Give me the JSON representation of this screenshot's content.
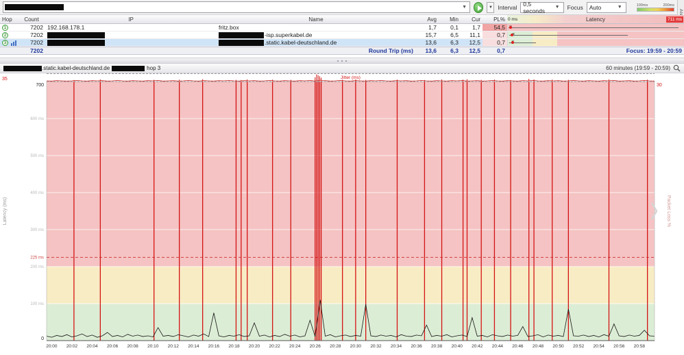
{
  "toolbar": {
    "interval_label": "Interval",
    "interval_value": "0,5 seconds",
    "focus_label": "Focus",
    "focus_value": "Auto",
    "legend": {
      "t1": "100ms",
      "t2": "200ms"
    },
    "alerts_tab": "Alerts"
  },
  "table": {
    "headers": {
      "hop": "Hop",
      "count": "Count",
      "ip": "IP",
      "name": "Name",
      "avg": "Avg",
      "min": "Min",
      "cur": "Cur",
      "pl": "PL%",
      "latency": "Latency",
      "lat_left": "0 ms",
      "lat_right": "711 ms"
    },
    "rows": [
      {
        "hop": "1",
        "count": "7202",
        "ip": "192.168.178.1",
        "name": "fritz.box",
        "avg": "1,7",
        "min": "0,1",
        "cur": "1,7",
        "pl": "54,5",
        "bar": {
          "min_pct": 0.5,
          "max_pct": 97,
          "cur_pct": 0.8,
          "avg_pct": 0.8
        }
      },
      {
        "hop": "2",
        "count": "7202",
        "ip": "",
        "name": "-isp.superkabel.de",
        "avg": "15,7",
        "min": "6,5",
        "cur": "11,1",
        "pl": "0,7",
        "bar": {
          "min_pct": 0.9,
          "max_pct": 68,
          "cur_pct": 1.6,
          "avg_pct": 2.4
        }
      },
      {
        "hop": "3",
        "count": "7202",
        "ip": "",
        "name": ".static.kabel-deutschland.de",
        "avg": "13,6",
        "min": "6,3",
        "cur": "12,5",
        "pl": "0,7",
        "bar": {
          "min_pct": 0.9,
          "max_pct": 16,
          "cur_pct": 1.8,
          "avg_pct": 2.1
        }
      }
    ],
    "summary": {
      "count": "7202",
      "label": "Round Trip (ms)",
      "avg": "13,6",
      "min": "6,3",
      "cur": "12,5",
      "pl": "0,7",
      "focus": "Focus: 19:59 - 20:59"
    }
  },
  "graph_header": {
    "name_suffix": ".static.kabel-deutschland.de",
    "hop_label": "hop 3",
    "range_label": "60 minutes (19:59 - 20:59)"
  },
  "colors": {
    "red": "#d41313",
    "threshold": "#d04545",
    "zone_red": "#f5c3c3",
    "zone_yellow": "#f8ecc4",
    "zone_green": "#dcedd5",
    "badge_green": "#3f9e3f",
    "selection_blue": "#cfe4f7",
    "summary_blue": "#20379b"
  },
  "chart_data": {
    "type": "line",
    "ylabel": "Latency (ms)",
    "y_right_label": "Packet Loss %",
    "ylim": [
      0,
      700
    ],
    "y_axis_top_label": "700",
    "y_axis_bottom_label": "0",
    "right_axis_top_label": "30",
    "jitter_scale_label": "35",
    "jitter_label": "Jitter (ms)",
    "threshold_ms": 225,
    "threshold_label": "225 ms",
    "zone_green_max_ms": 100,
    "zone_yellow_max_ms": 200,
    "gridline_step_ms": 100,
    "duration_min": 60,
    "x_ticks": [
      "20:00",
      "20:02",
      "20:04",
      "20:06",
      "20:08",
      "20:10",
      "20:12",
      "20:14",
      "20:16",
      "20:18",
      "20:20",
      "20:22",
      "20:24",
      "20:26",
      "20:28",
      "20:30",
      "20:32",
      "20:34",
      "20:36",
      "20:38",
      "20:40",
      "20:42",
      "20:44",
      "20:46",
      "20:48",
      "20:50",
      "20:52",
      "20:54",
      "20:56",
      "20:58"
    ],
    "packet_loss_events": [
      [
        2.7,
        6
      ],
      [
        5.3,
        9
      ],
      [
        10.6,
        7
      ],
      [
        13.1,
        8
      ],
      [
        15.4,
        10
      ],
      [
        18.7,
        7
      ],
      [
        19.2,
        6
      ],
      [
        19.8,
        9
      ],
      [
        22.3,
        8
      ],
      [
        24.1,
        7
      ],
      [
        26.5,
        20
      ],
      [
        26.65,
        35
      ],
      [
        26.8,
        30
      ],
      [
        26.95,
        25
      ],
      [
        27.1,
        18
      ],
      [
        29.2,
        8
      ],
      [
        30.5,
        9
      ],
      [
        31.5,
        7
      ],
      [
        34.6,
        8
      ],
      [
        37.3,
        6
      ],
      [
        39.0,
        9
      ],
      [
        41.1,
        8
      ],
      [
        41.5,
        10
      ],
      [
        42.9,
        7
      ],
      [
        44.2,
        8
      ],
      [
        45.8,
        6
      ],
      [
        47.6,
        12
      ],
      [
        48.1,
        9
      ],
      [
        49.9,
        8
      ],
      [
        51.5,
        7
      ],
      [
        55.5,
        9
      ],
      [
        59.3,
        8
      ]
    ],
    "latency_samples_ms": [
      12,
      9,
      14,
      11,
      16,
      10,
      13,
      18,
      11,
      15,
      9,
      13,
      22,
      11,
      14,
      10,
      17,
      12,
      15,
      11,
      13,
      10,
      35,
      12,
      14,
      11,
      16,
      13,
      10,
      15,
      12,
      18,
      11,
      75,
      13,
      10,
      14,
      12,
      16,
      11,
      13,
      48,
      12,
      15,
      10,
      14,
      11,
      17,
      12,
      15,
      10,
      13,
      55,
      11,
      110,
      12,
      16,
      10,
      13,
      15,
      11,
      14,
      12,
      98,
      13,
      11,
      15,
      12,
      14,
      10,
      16,
      12,
      11,
      15,
      13,
      42,
      11,
      14,
      12,
      16,
      10,
      13,
      15,
      11,
      62,
      12,
      14,
      10,
      16,
      13,
      11,
      15,
      12,
      14,
      38,
      11,
      13,
      16,
      10,
      15,
      12,
      14,
      11,
      85,
      13,
      12,
      15,
      11,
      14,
      10,
      16,
      12,
      45,
      13,
      11,
      15,
      12,
      14,
      28,
      13,
      12
    ],
    "jitter_samples": [
      2,
      1,
      3,
      2,
      1,
      2,
      4,
      2,
      1,
      3,
      2,
      3,
      1,
      2,
      4,
      2,
      1,
      3,
      2,
      1,
      3,
      2,
      4,
      1,
      2,
      3,
      1,
      2,
      4,
      2,
      1,
      3,
      2,
      1,
      3,
      2,
      4,
      2,
      1,
      3,
      2,
      3,
      1,
      2,
      4,
      2,
      1,
      3,
      2,
      1,
      3,
      2,
      4,
      1,
      5,
      3,
      1,
      2,
      4,
      2,
      1,
      3,
      2,
      1,
      3,
      2,
      4,
      2,
      1,
      3,
      2,
      3,
      1,
      2,
      4,
      2,
      1,
      3,
      2,
      1,
      3,
      2,
      4,
      1,
      2,
      3,
      1,
      2,
      4,
      2,
      1,
      3,
      2,
      1,
      3,
      2,
      4,
      2,
      1,
      3,
      2,
      3,
      1,
      2,
      4,
      2,
      1,
      3,
      2,
      1,
      3,
      2,
      4,
      1,
      2,
      3,
      1,
      2,
      4,
      2,
      1
    ]
  }
}
